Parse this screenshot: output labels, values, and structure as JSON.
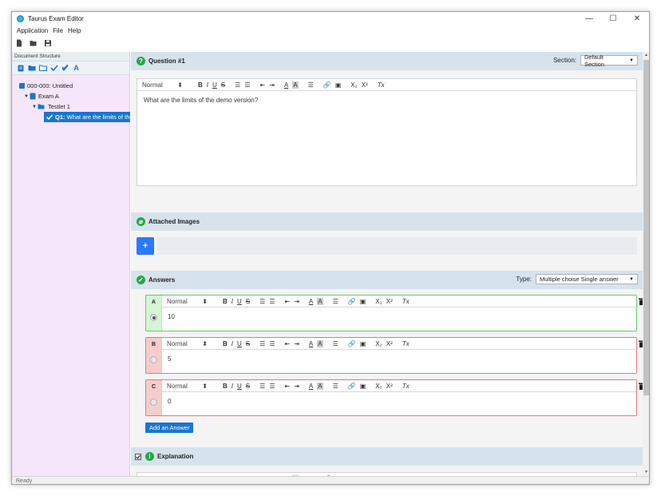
{
  "window": {
    "title": "Taurus Exam Editor",
    "minimize": "—",
    "maximize": "☐",
    "close": "✕"
  },
  "menu": [
    "Application",
    "File",
    "Help"
  ],
  "toolbar": {
    "icons": [
      "new-document-icon",
      "open-folder-icon",
      "save-icon"
    ]
  },
  "left_panel": {
    "header": "Document Structure",
    "tools": [
      "add-document-icon",
      "add-folder-icon",
      "open-folder-icon",
      "check-icon",
      "double-check-icon",
      "font-icon"
    ],
    "tree": {
      "root": "000-000: Untitled",
      "exam": "Exam A",
      "testlet": "Testlet 1",
      "question_prefix": "Q1:",
      "question": "What are the limits of the demo version?"
    }
  },
  "question": {
    "icon": "?",
    "title": "Question #1",
    "section_label": "Section:",
    "section_value": "Default Section",
    "text": "What are the limits of the demo version?"
  },
  "editor_toolbar": {
    "format": "Normal",
    "updown": "⬍",
    "bold": "B",
    "italic": "I",
    "underline": "U",
    "strike": "S",
    "ol": "☰",
    "ul": "☰",
    "outdent": "⇤",
    "indent": "⇥",
    "color": "A",
    "bg": "A",
    "align": "☰",
    "link": "🔗",
    "image": "▣",
    "sub": "X₂",
    "sup": "X²",
    "clear": "Tx"
  },
  "attached_images": {
    "title": "Attached Images",
    "add": "+"
  },
  "answers": {
    "title": "Answers",
    "type_label": "Type:",
    "type_value": "Multiple choise Single answer",
    "items": [
      {
        "letter": "A",
        "text": "10"
      },
      {
        "letter": "B",
        "text": "5"
      },
      {
        "letter": "C",
        "text": "0"
      }
    ],
    "add_button": "Add an Answer"
  },
  "explanation": {
    "title": "Explanation",
    "icon": "i"
  },
  "status": "Ready"
}
